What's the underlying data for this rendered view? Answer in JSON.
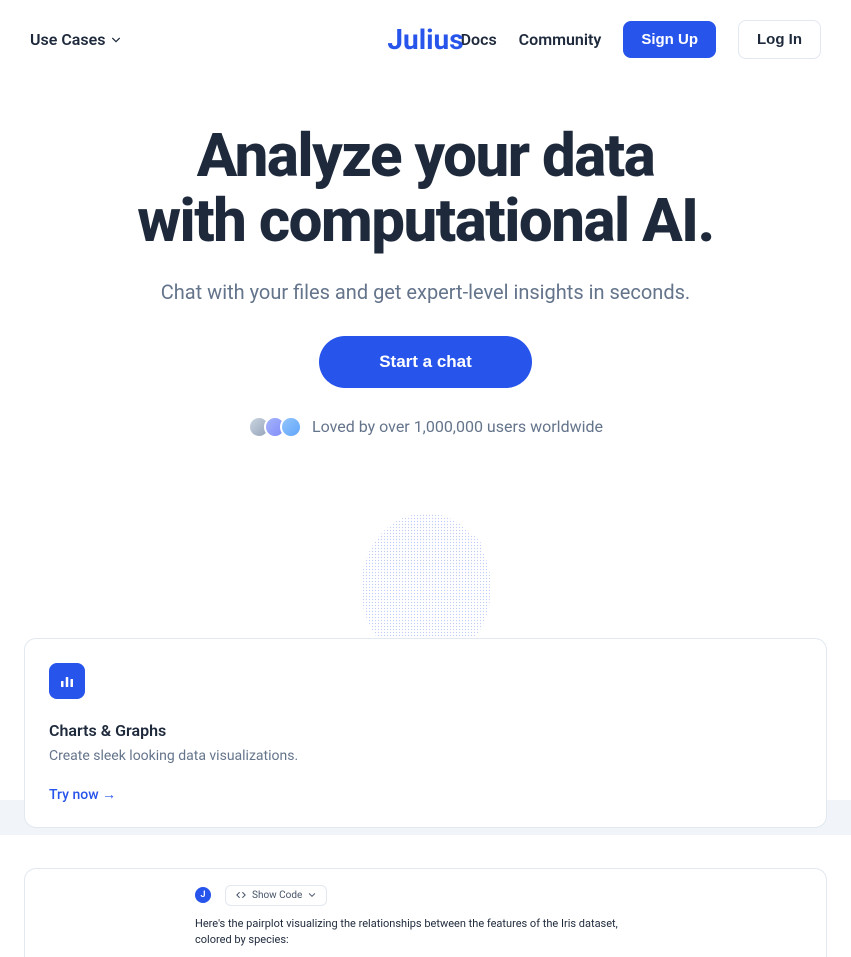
{
  "header": {
    "use_cases_label": "Use Cases",
    "logo_text": "Julius",
    "nav": {
      "docs": "Docs",
      "community": "Community"
    },
    "signup_label": "Sign Up",
    "login_label": "Log In"
  },
  "hero": {
    "title_line1": "Analyze your data",
    "title_line2": "with computational AI.",
    "subtitle": "Chat with your files and get expert-level insights in seconds.",
    "cta_label": "Start a chat",
    "social_proof": "Loved by over 1,000,000 users worldwide"
  },
  "card": {
    "title": "Charts & Graphs",
    "description": "Create sleek looking data visualizations.",
    "link_label": "Try now →"
  },
  "preview": {
    "avatar_letter": "J",
    "show_code_label": "Show Code",
    "message": "Here's the pairplot visualizing the relationships between the features of the Iris dataset, colored by species:"
  }
}
